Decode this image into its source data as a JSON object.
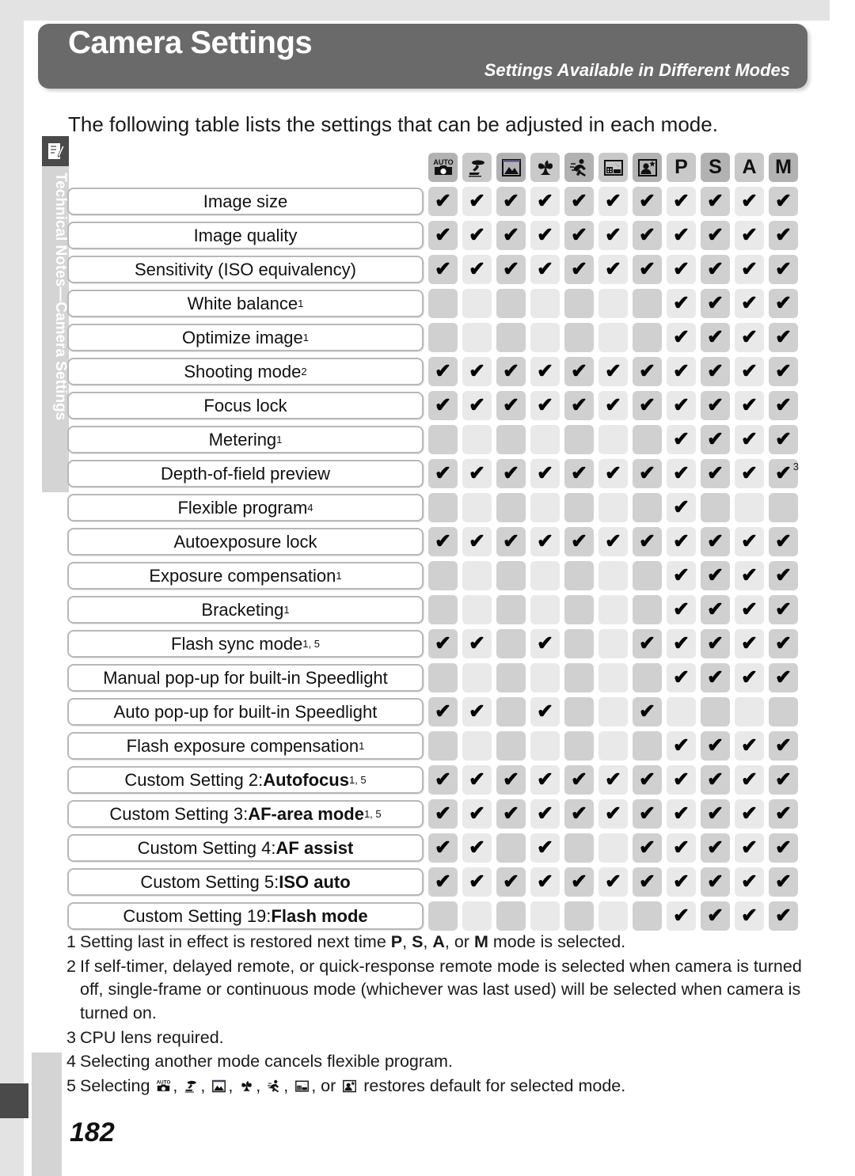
{
  "banner": {
    "title": "Camera Settings",
    "subtitle": "Settings Available in Different Modes"
  },
  "intro": "The following table lists the settings that can be adjusted in each mode.",
  "sidebar": {
    "icon": "notes-pencil-icon",
    "label": "Technical Notes—Camera Settings"
  },
  "page_number": "182",
  "colors": {
    "banner_bg": "#6a6a6a",
    "frame_bg": "#e3e3e3",
    "tab_bg": "#d4d4d4",
    "tab_icon_bg": "#4a4a4a",
    "col_dark": "#d0d0d0",
    "col_light": "#e9e9e9",
    "mode_dark": "#b2b2b2",
    "mode_light": "#c9c9c9"
  },
  "check_glyph": "✔",
  "table": {
    "mode_columns": [
      {
        "key": "auto",
        "icon": "mode-auto-icon",
        "label": "",
        "shade": "dark"
      },
      {
        "key": "portrait",
        "icon": "mode-portrait-icon",
        "label": "",
        "shade": "light"
      },
      {
        "key": "landscape",
        "icon": "mode-landscape-icon",
        "label": "",
        "shade": "dark"
      },
      {
        "key": "close-up",
        "icon": "mode-close-up-icon",
        "label": "",
        "shade": "light"
      },
      {
        "key": "sports",
        "icon": "mode-sports-icon",
        "label": "",
        "shade": "dark"
      },
      {
        "key": "night-landscape",
        "icon": "mode-night-landscape-icon",
        "label": "",
        "shade": "light"
      },
      {
        "key": "night-portrait",
        "icon": "mode-night-portrait-icon",
        "label": "",
        "shade": "dark"
      },
      {
        "key": "P",
        "icon": "mode-p-letter",
        "label": "P",
        "shade": "light"
      },
      {
        "key": "S",
        "icon": "mode-s-letter",
        "label": "S",
        "shade": "dark"
      },
      {
        "key": "A",
        "icon": "mode-a-letter",
        "label": "A",
        "shade": "light"
      },
      {
        "key": "M",
        "icon": "mode-m-letter",
        "label": "M",
        "shade": "dark"
      }
    ],
    "rows": [
      {
        "label": "Image size",
        "sup": "",
        "bold": "",
        "checks": [
          1,
          1,
          1,
          1,
          1,
          1,
          1,
          1,
          1,
          1,
          1
        ]
      },
      {
        "label": "Image quality",
        "sup": "",
        "bold": "",
        "checks": [
          1,
          1,
          1,
          1,
          1,
          1,
          1,
          1,
          1,
          1,
          1
        ]
      },
      {
        "label": "Sensitivity (ISO equivalency)",
        "sup": "",
        "bold": "",
        "checks": [
          1,
          1,
          1,
          1,
          1,
          1,
          1,
          1,
          1,
          1,
          1
        ]
      },
      {
        "label": "White balance",
        "sup": "1",
        "bold": "",
        "checks": [
          0,
          0,
          0,
          0,
          0,
          0,
          0,
          1,
          1,
          1,
          1
        ]
      },
      {
        "label": "Optimize image",
        "sup": "1",
        "bold": "",
        "checks": [
          0,
          0,
          0,
          0,
          0,
          0,
          0,
          1,
          1,
          1,
          1
        ]
      },
      {
        "label": "Shooting mode",
        "sup": "2",
        "bold": "",
        "checks": [
          1,
          1,
          1,
          1,
          1,
          1,
          1,
          1,
          1,
          1,
          1
        ]
      },
      {
        "label": "Focus lock",
        "sup": "",
        "bold": "",
        "checks": [
          1,
          1,
          1,
          1,
          1,
          1,
          1,
          1,
          1,
          1,
          1
        ]
      },
      {
        "label": "Metering",
        "sup": "1",
        "bold": "",
        "checks": [
          0,
          0,
          0,
          0,
          0,
          0,
          0,
          1,
          1,
          1,
          1
        ]
      },
      {
        "label": "Depth-of-field preview",
        "sup": "",
        "bold": "",
        "checks": [
          1,
          1,
          1,
          1,
          1,
          1,
          1,
          1,
          1,
          1,
          1
        ],
        "check_sup": {
          "10": "3"
        }
      },
      {
        "label": "Flexible program",
        "sup": "4",
        "bold": "",
        "checks": [
          0,
          0,
          0,
          0,
          0,
          0,
          0,
          1,
          0,
          0,
          0
        ]
      },
      {
        "label": "Autoexposure lock",
        "sup": "",
        "bold": "",
        "checks": [
          1,
          1,
          1,
          1,
          1,
          1,
          1,
          1,
          1,
          1,
          1
        ]
      },
      {
        "label": "Exposure compensation",
        "sup": "1",
        "bold": "",
        "checks": [
          0,
          0,
          0,
          0,
          0,
          0,
          0,
          1,
          1,
          1,
          1
        ]
      },
      {
        "label": "Bracketing",
        "sup": "1",
        "bold": "",
        "checks": [
          0,
          0,
          0,
          0,
          0,
          0,
          0,
          1,
          1,
          1,
          1
        ]
      },
      {
        "label": "Flash sync mode",
        "sup": "1, 5",
        "bold": "",
        "checks": [
          1,
          1,
          0,
          1,
          0,
          0,
          1,
          1,
          1,
          1,
          1
        ]
      },
      {
        "label": "Manual pop-up for built-in Speedlight",
        "sup": "",
        "bold": "",
        "checks": [
          0,
          0,
          0,
          0,
          0,
          0,
          0,
          1,
          1,
          1,
          1
        ]
      },
      {
        "label": "Auto pop-up for built-in Speedlight",
        "sup": "",
        "bold": "",
        "checks": [
          1,
          1,
          0,
          1,
          0,
          0,
          1,
          0,
          0,
          0,
          0
        ]
      },
      {
        "label": "Flash exposure compensation",
        "sup": "1",
        "bold": "",
        "checks": [
          0,
          0,
          0,
          0,
          0,
          0,
          0,
          1,
          1,
          1,
          1
        ]
      },
      {
        "label": "Custom Setting 2: ",
        "sup": "1, 5",
        "bold": "Autofocus",
        "checks": [
          1,
          1,
          1,
          1,
          1,
          1,
          1,
          1,
          1,
          1,
          1
        ]
      },
      {
        "label": "Custom Setting 3: ",
        "sup": "1, 5",
        "bold": "AF-area mode",
        "checks": [
          1,
          1,
          1,
          1,
          1,
          1,
          1,
          1,
          1,
          1,
          1
        ]
      },
      {
        "label": "Custom Setting 4: ",
        "sup": "",
        "bold": "AF assist",
        "checks": [
          1,
          1,
          0,
          1,
          0,
          0,
          1,
          1,
          1,
          1,
          1
        ]
      },
      {
        "label": "Custom Setting 5: ",
        "sup": "",
        "bold": "ISO auto",
        "checks": [
          1,
          1,
          1,
          1,
          1,
          1,
          1,
          1,
          1,
          1,
          1
        ]
      },
      {
        "label": "Custom Setting 19: ",
        "sup": "",
        "bold": "Flash mode",
        "checks": [
          0,
          0,
          0,
          0,
          0,
          0,
          0,
          1,
          1,
          1,
          1
        ]
      }
    ]
  },
  "footnotes": [
    {
      "num": "1",
      "text_parts": [
        {
          "t": "Setting last in effect is restored next time "
        },
        {
          "t": "P",
          "b": true
        },
        {
          "t": ", "
        },
        {
          "t": "S",
          "b": true
        },
        {
          "t": ", "
        },
        {
          "t": "A",
          "b": true
        },
        {
          "t": ", or "
        },
        {
          "t": "M",
          "b": true
        },
        {
          "t": " mode is selected."
        }
      ]
    },
    {
      "num": "2",
      "text_parts": [
        {
          "t": "If self-timer, delayed remote, or quick-response remote mode is selected when camera is turned off, single-frame or continuous mode (whichever was last used) will be selected when camera is turned on."
        }
      ]
    },
    {
      "num": "3",
      "text_parts": [
        {
          "t": "CPU lens required."
        }
      ]
    },
    {
      "num": "4",
      "text_parts": [
        {
          "t": "Selecting another mode cancels flexible program."
        }
      ]
    },
    {
      "num": "5",
      "text_parts": [
        {
          "t": "Selecting "
        },
        {
          "icon": "mode-auto-icon"
        },
        {
          "t": ", "
        },
        {
          "icon": "mode-portrait-icon"
        },
        {
          "t": ", "
        },
        {
          "icon": "mode-landscape-icon"
        },
        {
          "t": ", "
        },
        {
          "icon": "mode-close-up-icon"
        },
        {
          "t": ", "
        },
        {
          "icon": "mode-sports-icon"
        },
        {
          "t": ", "
        },
        {
          "icon": "mode-night-landscape-icon"
        },
        {
          "t": ", or "
        },
        {
          "icon": "mode-night-portrait-icon"
        },
        {
          "t": " restores default for selected mode."
        }
      ]
    }
  ]
}
